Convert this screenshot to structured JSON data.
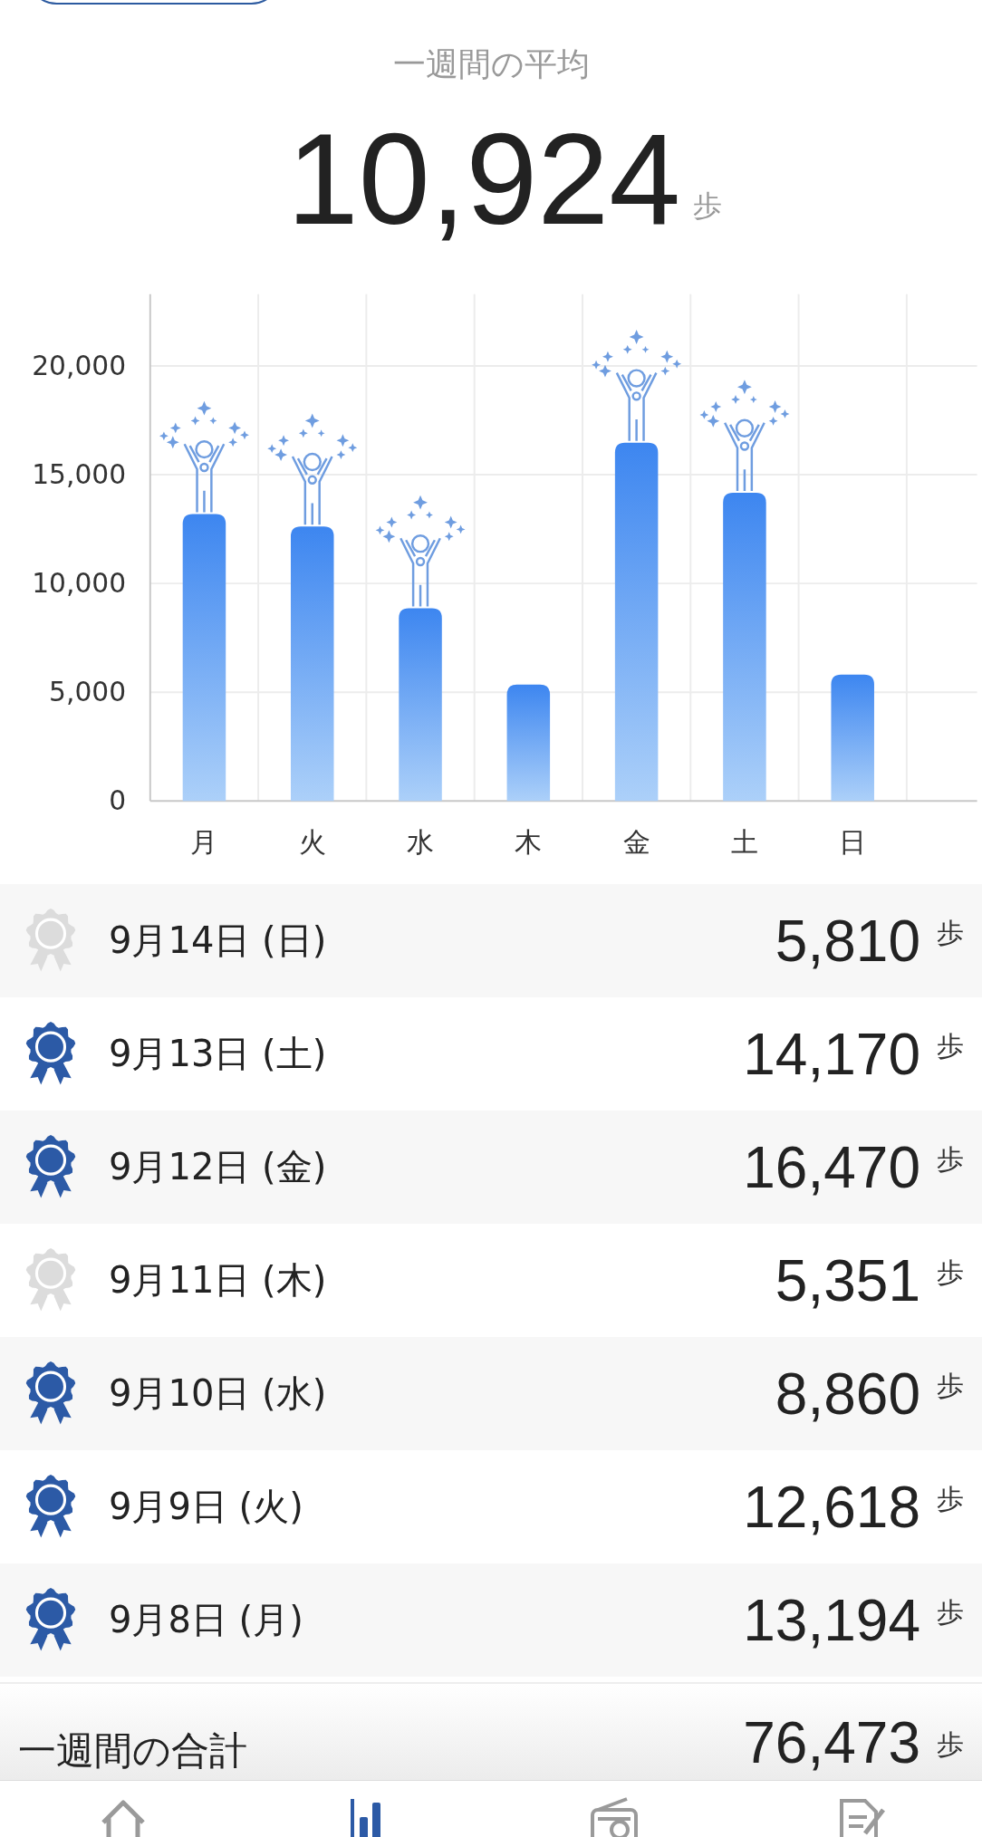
{
  "summary": {
    "label": "一週間の平均",
    "value": "10,924",
    "unit": "歩"
  },
  "chart": {
    "chart_data": {
      "type": "bar",
      "grid": true,
      "categories": [
        "月",
        "火",
        "水",
        "木",
        "金",
        "土",
        "日"
      ],
      "values": [
        13194,
        12618,
        8860,
        5351,
        16470,
        14170,
        5810
      ],
      "ylim": [
        0,
        23300
      ],
      "yticks": [
        {
          "value": 0,
          "label": "0"
        },
        {
          "value": 5000,
          "label": "5,000"
        },
        {
          "value": 10000,
          "label": "10,000"
        },
        {
          "value": 15000,
          "label": "15,000"
        },
        {
          "value": 20000,
          "label": "20,000"
        }
      ]
    }
  },
  "days": [
    {
      "date": "9月14日 (日)",
      "steps": "5,810",
      "unit": "歩",
      "achieved": false
    },
    {
      "date": "9月13日 (土)",
      "steps": "14,170",
      "unit": "歩",
      "achieved": true
    },
    {
      "date": "9月12日 (金)",
      "steps": "16,470",
      "unit": "歩",
      "achieved": true
    },
    {
      "date": "9月11日 (木)",
      "steps": "5,351",
      "unit": "歩",
      "achieved": false
    },
    {
      "date": "9月10日 (水)",
      "steps": "8,860",
      "unit": "歩",
      "achieved": true
    },
    {
      "date": "9月9日 (火)",
      "steps": "12,618",
      "unit": "歩",
      "achieved": true
    },
    {
      "date": "9月8日 (月)",
      "steps": "13,194",
      "unit": "歩",
      "achieved": true
    }
  ],
  "total": {
    "label": "一週間の合計",
    "value": "76,473",
    "unit": "歩"
  },
  "tab_bar": [
    {
      "selected": false
    },
    {
      "selected": true
    },
    {
      "selected": false
    },
    {
      "selected": false
    }
  ]
}
